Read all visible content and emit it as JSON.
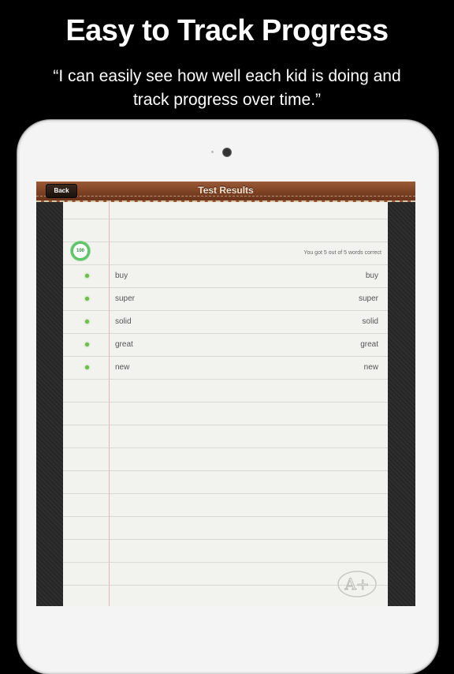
{
  "marketing": {
    "headline": "Easy to Track Progress",
    "quote": "“I can easily see how well each kid is doing and track progress over time.”"
  },
  "navbar": {
    "back_label": "Back",
    "title": "Test Results"
  },
  "results": {
    "score_badge": "100",
    "summary": "You got 5 out of 5 words correct",
    "rows": [
      {
        "status": "correct",
        "word": "buy",
        "answer": "buy"
      },
      {
        "status": "correct",
        "word": "super",
        "answer": "super"
      },
      {
        "status": "correct",
        "word": "solid",
        "answer": "solid"
      },
      {
        "status": "correct",
        "word": "great",
        "answer": "great"
      },
      {
        "status": "correct",
        "word": "new",
        "answer": "new"
      }
    ]
  },
  "grade_stamp": "A+",
  "colors": {
    "correct": "#6bbf4a",
    "navbar": "#7a3f22",
    "paper": "#f2f2ee"
  }
}
